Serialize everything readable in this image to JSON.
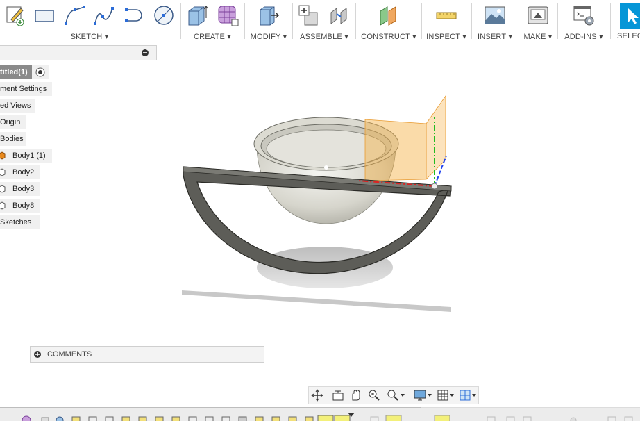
{
  "toolbar": {
    "groups": [
      {
        "label": "SKETCH ▾"
      },
      {
        "label": "CREATE ▾"
      },
      {
        "label": "MODIFY ▾"
      },
      {
        "label": "ASSEMBLE ▾"
      },
      {
        "label": "CONSTRUCT ▾"
      },
      {
        "label": "INSPECT ▾"
      },
      {
        "label": "INSERT ▾"
      },
      {
        "label": "MAKE ▾"
      },
      {
        "label": "ADD-INS ▾"
      },
      {
        "label": "SELECT"
      }
    ]
  },
  "browser": {
    "root_label": "titled(1)",
    "nodes": [
      {
        "label": "ment Settings"
      },
      {
        "label": "ed Views"
      },
      {
        "label": "Origin"
      },
      {
        "label": "Bodies"
      },
      {
        "label": "Body1 (1)"
      },
      {
        "label": "Body2"
      },
      {
        "label": "Body3"
      },
      {
        "label": "Body8"
      },
      {
        "label": "Sketches"
      }
    ]
  },
  "comments": {
    "label": "COMMENTS"
  },
  "colors": {
    "accent": "#0696d7",
    "body_highlight": "#e8891d",
    "plane": "#f5b041"
  }
}
